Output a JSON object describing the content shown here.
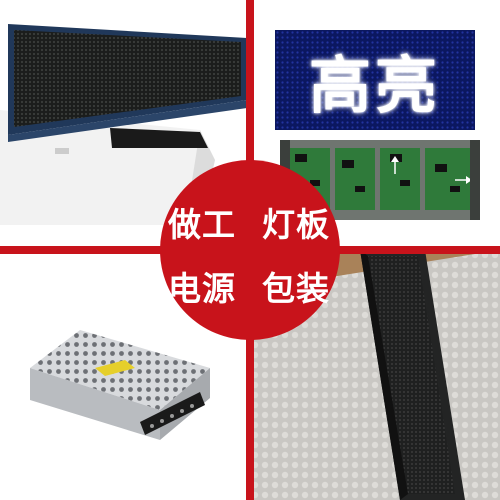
{
  "center_labels": {
    "top_left": "做工",
    "top_right": "灯板",
    "bottom_left": "电源",
    "bottom_right": "包装"
  },
  "led_panel_text": "高亮",
  "colors": {
    "accent_red": "#c8131b",
    "led_glow": "#ffffff",
    "pcb_green": "#2f7a3a"
  },
  "panels": {
    "top_left": "led-display-side-view",
    "top_right_upper": "led-module-lit",
    "top_right_lower": "led-module-back-pcb",
    "bottom_left": "power-supply-unit",
    "bottom_right": "packaged-display"
  }
}
